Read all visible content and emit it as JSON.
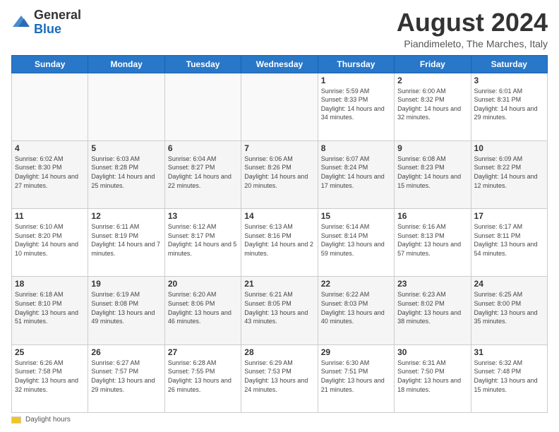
{
  "header": {
    "logo_line1": "General",
    "logo_line2": "Blue",
    "month_title": "August 2024",
    "subtitle": "Piandimeleto, The Marches, Italy"
  },
  "days_of_week": [
    "Sunday",
    "Monday",
    "Tuesday",
    "Wednesday",
    "Thursday",
    "Friday",
    "Saturday"
  ],
  "footer": {
    "daylight_label": "Daylight hours"
  },
  "weeks": [
    [
      {
        "day": "",
        "info": ""
      },
      {
        "day": "",
        "info": ""
      },
      {
        "day": "",
        "info": ""
      },
      {
        "day": "",
        "info": ""
      },
      {
        "day": "1",
        "info": "Sunrise: 5:59 AM\nSunset: 8:33 PM\nDaylight: 14 hours and 34 minutes."
      },
      {
        "day": "2",
        "info": "Sunrise: 6:00 AM\nSunset: 8:32 PM\nDaylight: 14 hours and 32 minutes."
      },
      {
        "day": "3",
        "info": "Sunrise: 6:01 AM\nSunset: 8:31 PM\nDaylight: 14 hours and 29 minutes."
      }
    ],
    [
      {
        "day": "4",
        "info": "Sunrise: 6:02 AM\nSunset: 8:30 PM\nDaylight: 14 hours and 27 minutes."
      },
      {
        "day": "5",
        "info": "Sunrise: 6:03 AM\nSunset: 8:28 PM\nDaylight: 14 hours and 25 minutes."
      },
      {
        "day": "6",
        "info": "Sunrise: 6:04 AM\nSunset: 8:27 PM\nDaylight: 14 hours and 22 minutes."
      },
      {
        "day": "7",
        "info": "Sunrise: 6:06 AM\nSunset: 8:26 PM\nDaylight: 14 hours and 20 minutes."
      },
      {
        "day": "8",
        "info": "Sunrise: 6:07 AM\nSunset: 8:24 PM\nDaylight: 14 hours and 17 minutes."
      },
      {
        "day": "9",
        "info": "Sunrise: 6:08 AM\nSunset: 8:23 PM\nDaylight: 14 hours and 15 minutes."
      },
      {
        "day": "10",
        "info": "Sunrise: 6:09 AM\nSunset: 8:22 PM\nDaylight: 14 hours and 12 minutes."
      }
    ],
    [
      {
        "day": "11",
        "info": "Sunrise: 6:10 AM\nSunset: 8:20 PM\nDaylight: 14 hours and 10 minutes."
      },
      {
        "day": "12",
        "info": "Sunrise: 6:11 AM\nSunset: 8:19 PM\nDaylight: 14 hours and 7 minutes."
      },
      {
        "day": "13",
        "info": "Sunrise: 6:12 AM\nSunset: 8:17 PM\nDaylight: 14 hours and 5 minutes."
      },
      {
        "day": "14",
        "info": "Sunrise: 6:13 AM\nSunset: 8:16 PM\nDaylight: 14 hours and 2 minutes."
      },
      {
        "day": "15",
        "info": "Sunrise: 6:14 AM\nSunset: 8:14 PM\nDaylight: 13 hours and 59 minutes."
      },
      {
        "day": "16",
        "info": "Sunrise: 6:16 AM\nSunset: 8:13 PM\nDaylight: 13 hours and 57 minutes."
      },
      {
        "day": "17",
        "info": "Sunrise: 6:17 AM\nSunset: 8:11 PM\nDaylight: 13 hours and 54 minutes."
      }
    ],
    [
      {
        "day": "18",
        "info": "Sunrise: 6:18 AM\nSunset: 8:10 PM\nDaylight: 13 hours and 51 minutes."
      },
      {
        "day": "19",
        "info": "Sunrise: 6:19 AM\nSunset: 8:08 PM\nDaylight: 13 hours and 49 minutes."
      },
      {
        "day": "20",
        "info": "Sunrise: 6:20 AM\nSunset: 8:06 PM\nDaylight: 13 hours and 46 minutes."
      },
      {
        "day": "21",
        "info": "Sunrise: 6:21 AM\nSunset: 8:05 PM\nDaylight: 13 hours and 43 minutes."
      },
      {
        "day": "22",
        "info": "Sunrise: 6:22 AM\nSunset: 8:03 PM\nDaylight: 13 hours and 40 minutes."
      },
      {
        "day": "23",
        "info": "Sunrise: 6:23 AM\nSunset: 8:02 PM\nDaylight: 13 hours and 38 minutes."
      },
      {
        "day": "24",
        "info": "Sunrise: 6:25 AM\nSunset: 8:00 PM\nDaylight: 13 hours and 35 minutes."
      }
    ],
    [
      {
        "day": "25",
        "info": "Sunrise: 6:26 AM\nSunset: 7:58 PM\nDaylight: 13 hours and 32 minutes."
      },
      {
        "day": "26",
        "info": "Sunrise: 6:27 AM\nSunset: 7:57 PM\nDaylight: 13 hours and 29 minutes."
      },
      {
        "day": "27",
        "info": "Sunrise: 6:28 AM\nSunset: 7:55 PM\nDaylight: 13 hours and 26 minutes."
      },
      {
        "day": "28",
        "info": "Sunrise: 6:29 AM\nSunset: 7:53 PM\nDaylight: 13 hours and 24 minutes."
      },
      {
        "day": "29",
        "info": "Sunrise: 6:30 AM\nSunset: 7:51 PM\nDaylight: 13 hours and 21 minutes."
      },
      {
        "day": "30",
        "info": "Sunrise: 6:31 AM\nSunset: 7:50 PM\nDaylight: 13 hours and 18 minutes."
      },
      {
        "day": "31",
        "info": "Sunrise: 6:32 AM\nSunset: 7:48 PM\nDaylight: 13 hours and 15 minutes."
      }
    ]
  ]
}
